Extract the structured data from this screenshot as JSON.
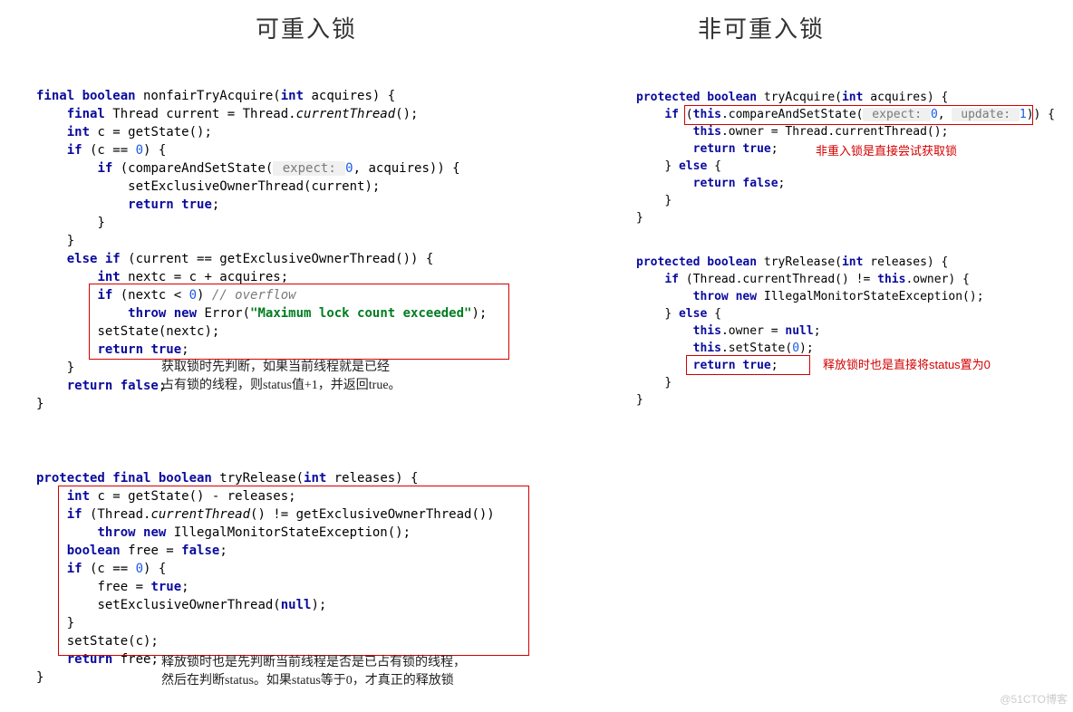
{
  "titles": {
    "left": "可重入锁",
    "right": "非可重入锁"
  },
  "left": {
    "nonfair": {
      "sig_kw1": "final boolean",
      "sig_name": " nonfairTryAcquire(",
      "sig_kw2": "int",
      "sig_rest": " acquires) {",
      "l2_kw": "final",
      "l2a": " Thread current = Thread.",
      "l2b_func": "currentThread",
      "l2c": "();",
      "l3_kw": "int",
      "l3": " c = getState();",
      "l4_kw": "if",
      "l4a": " (c == ",
      "l4_num": "0",
      "l4b": ") {",
      "l5_kw": "if",
      "l5a": " (compareAndSetState(",
      "l5_hint": " expect: ",
      "l5_num": "0",
      "l5b": ", acquires)) {",
      "l6": "setExclusiveOwnerThread(current);",
      "l7_kw": "return true",
      "l7": ";",
      "l8": "}",
      "l9": "}",
      "l10_kw": "else if",
      "l10": " (current == getExclusiveOwnerThread()) {",
      "l11_kw": "int",
      "l11": " nextc = c + acquires;",
      "l12_kw": "if",
      "l12a": " (nextc < ",
      "l12_num": "0",
      "l12b": ") ",
      "l12_comm": "// overflow",
      "l13_kw": "throw new",
      "l13a": " Error(",
      "l13_str": "\"Maximum lock count exceeded\"",
      "l13b": ");",
      "l14": "setState(nextc);",
      "l15_kw": "return true",
      "l15": ";",
      "l16": "}",
      "l17_kw": "return false",
      "l17": ";",
      "l18": "}"
    },
    "release": {
      "sig_kw1": "protected final boolean",
      "sig_name": " tryRelease(",
      "sig_kw2": "int",
      "sig_rest": " releases) {",
      "l2_kw": "int",
      "l2": " c = getState() - releases;",
      "l3_kw": "if",
      "l3a": " (Thread.",
      "l3b_func": "currentThread",
      "l3c": "() != getExclusiveOwnerThread())",
      "l4_kw": "throw new",
      "l4": " IllegalMonitorStateException();",
      "l5_kw": "boolean",
      "l5a": " free = ",
      "l5_kw2": "false",
      "l5b": ";",
      "l6_kw": "if",
      "l6a": " (c == ",
      "l6_num": "0",
      "l6b": ") {",
      "l7a": "free = ",
      "l7_kw": "true",
      "l7b": ";",
      "l8a": "setExclusiveOwnerThread(",
      "l8_kw": "null",
      "l8b": ");",
      "l9": "}",
      "l10": "setState(c);",
      "l11_kw": "return",
      "l11": " free;",
      "l12": "}"
    },
    "anno1": "获取锁时先判断，如果当前线程就是已经\n占有锁的线程，则status值+1，并返回true。",
    "anno2": "释放锁时也是先判断当前线程是否是已占有锁的线程，\n然后在判断status。如果status等于0，才真正的释放锁"
  },
  "right": {
    "acquire": {
      "sig_kw1": "protected boolean",
      "sig_name": " tryAcquire(",
      "sig_kw2": "int",
      "sig_rest": " acquires) {",
      "l2_kw": "if",
      "l2a": " (",
      "l2_kw2": "this",
      "l2b": ".compareAndSetState(",
      "l2_hint1": " expect: ",
      "l2_num1": "0",
      "l2c": ", ",
      "l2_hint2": " update: ",
      "l2_num2": "1",
      "l2d": ")) {",
      "l3_kw": "this",
      "l3": ".owner = Thread.currentThread();",
      "l4_kw": "return true",
      "l4": ";",
      "l5a": "} ",
      "l5_kw": "else",
      "l5b": " {",
      "l6_kw": "return false",
      "l6": ";",
      "l7": "}",
      "l8": "}"
    },
    "release": {
      "sig_kw1": "protected boolean",
      "sig_name": " tryRelease(",
      "sig_kw2": "int",
      "sig_rest": " releases) {",
      "l2_kw": "if",
      "l2a": " (Thread.currentThread() != ",
      "l2_kw2": "this",
      "l2b": ".owner) {",
      "l3_kw": "throw new",
      "l3": " IllegalMonitorStateException();",
      "l4a": "} ",
      "l4_kw": "else",
      "l4b": " {",
      "l5_kw": "this",
      "l5a": ".owner = ",
      "l5_kw2": "null",
      "l5b": ";",
      "l6_kw": "this",
      "l6a": ".setState(",
      "l6_num": "0",
      "l6b": ");",
      "l7_kw": "return true",
      "l7": ";",
      "l8": "}",
      "l9": "}"
    },
    "anno1": "非重入锁是直接尝试获取锁",
    "anno2": "释放锁时也是直接将status置为0"
  },
  "watermark": "@51CTO博客"
}
